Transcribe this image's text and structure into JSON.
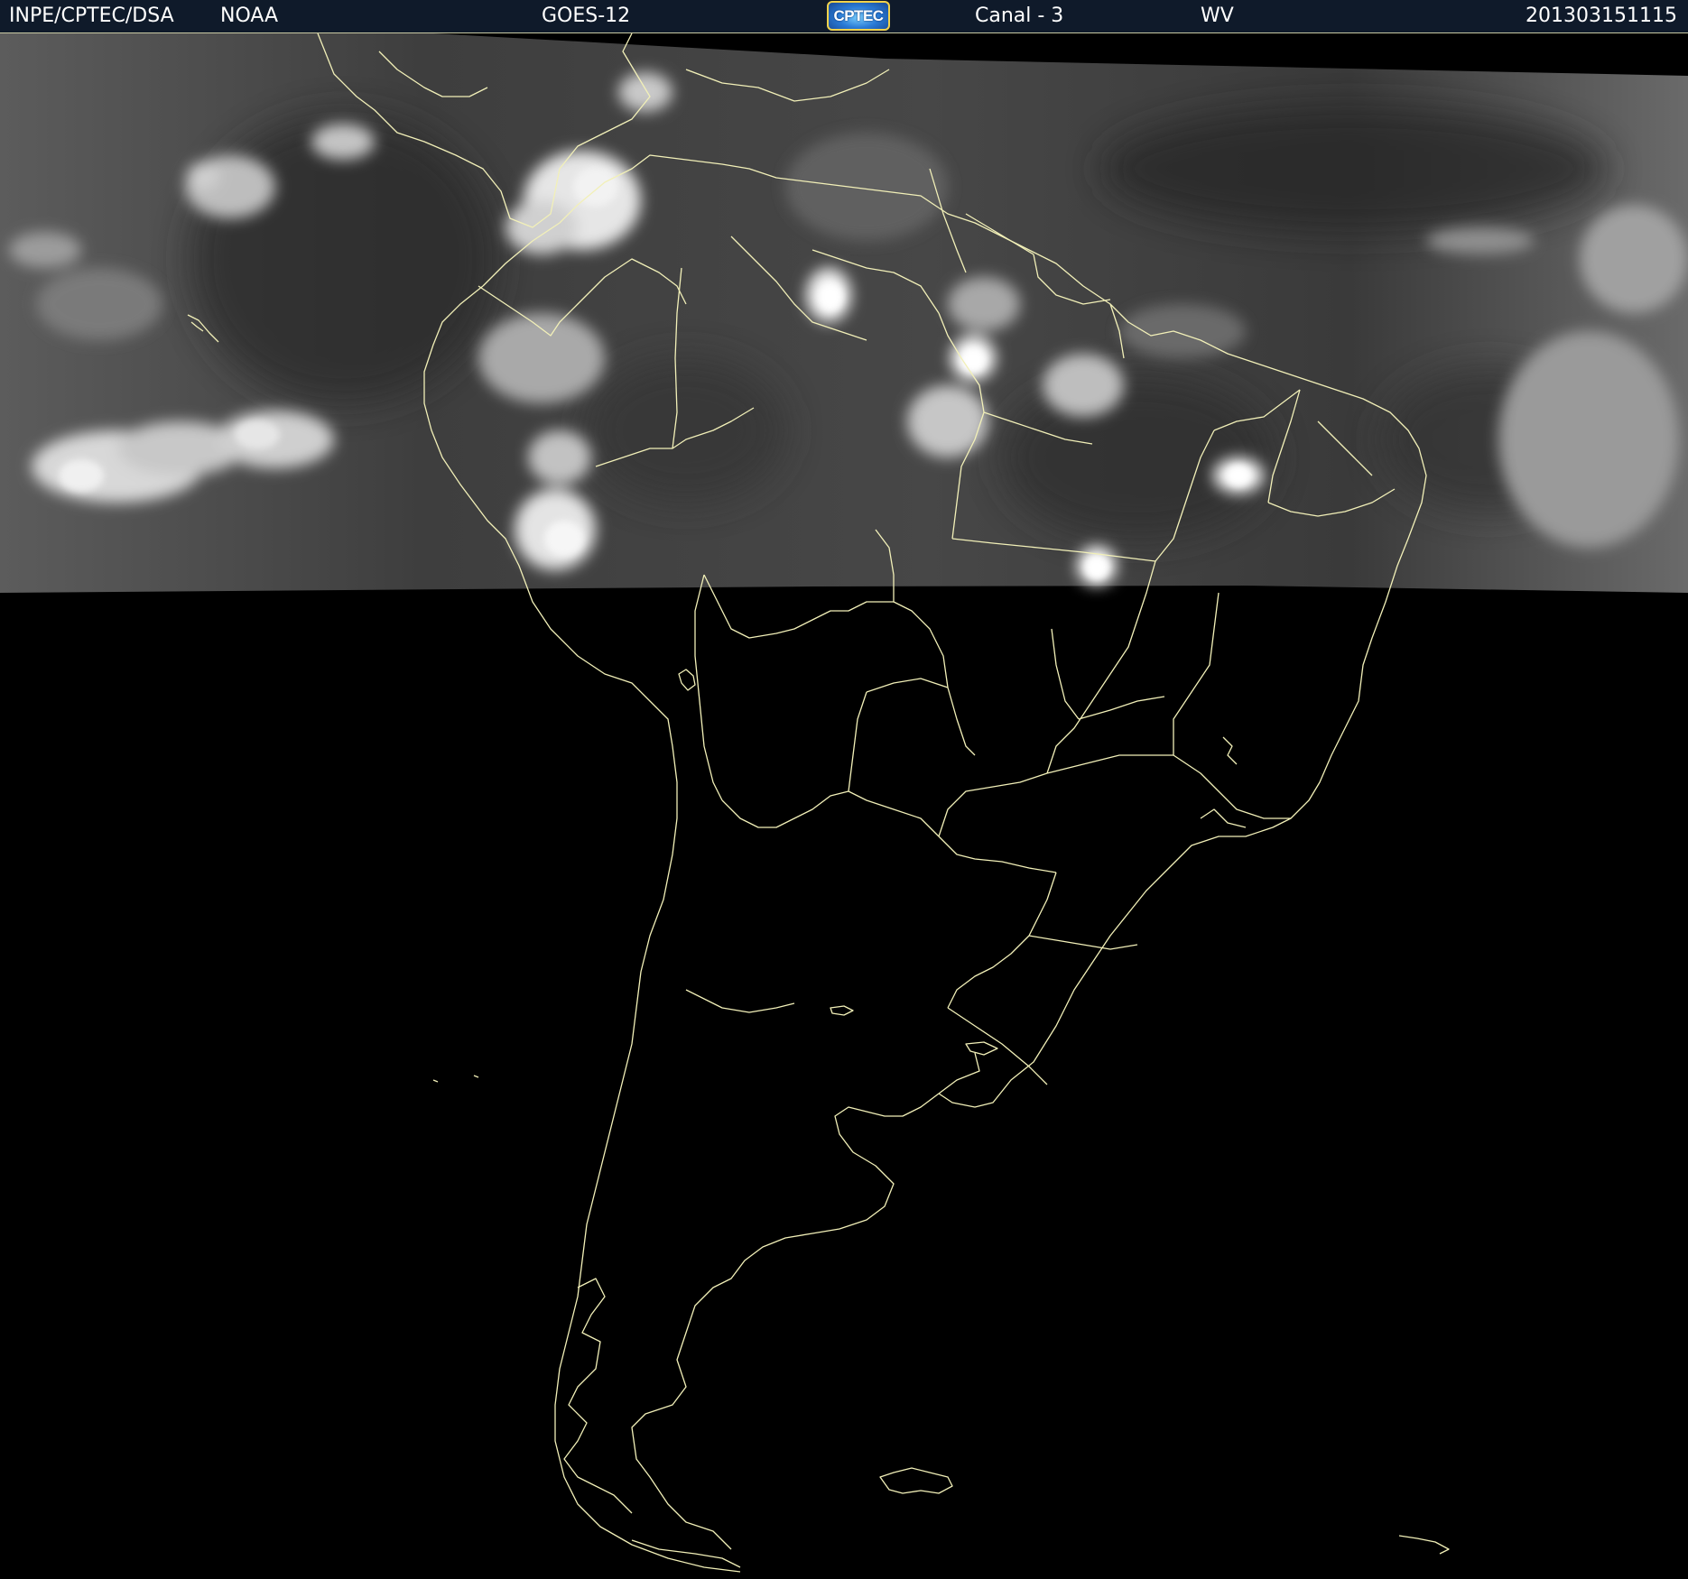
{
  "header": {
    "institution": "INPE/CPTEC/DSA",
    "agency": "NOAA",
    "satellite": "GOES-12",
    "logo_text": "CPTEC",
    "channel": "Canal - 3",
    "band": "WV",
    "timestamp": "201303151115"
  },
  "colors": {
    "header_bg": "#0f1a2a",
    "header_text": "#ffffff",
    "coastline": "#f2f0b8",
    "background": "#000000"
  },
  "icons": {
    "logo": "cptec-logo-icon"
  }
}
